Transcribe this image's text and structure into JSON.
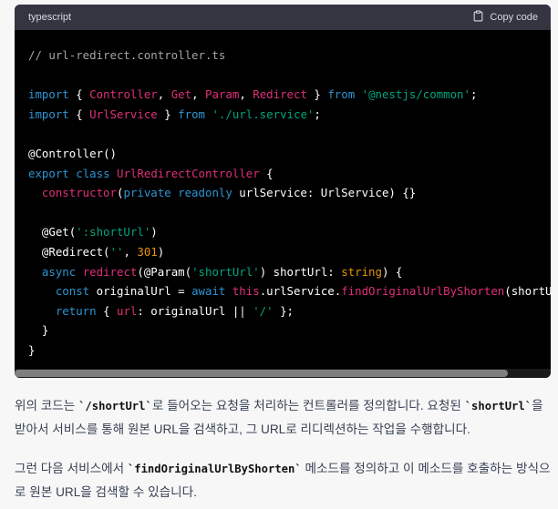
{
  "code_block": {
    "language": "typescript",
    "copy_label": "Copy code",
    "lines": [
      [
        {
          "t": "// url-redirect.controller.ts",
          "c": "c"
        }
      ],
      [],
      [
        {
          "t": "import",
          "c": "k"
        },
        {
          "t": " { ",
          "c": "w"
        },
        {
          "t": "Controller",
          "c": "r"
        },
        {
          "t": ", ",
          "c": "w"
        },
        {
          "t": "Get",
          "c": "r"
        },
        {
          "t": ", ",
          "c": "w"
        },
        {
          "t": "Param",
          "c": "r"
        },
        {
          "t": ", ",
          "c": "w"
        },
        {
          "t": "Redirect",
          "c": "r"
        },
        {
          "t": " } ",
          "c": "w"
        },
        {
          "t": "from",
          "c": "k"
        },
        {
          "t": " ",
          "c": "w"
        },
        {
          "t": "'@nestjs/common'",
          "c": "s"
        },
        {
          "t": ";",
          "c": "w"
        }
      ],
      [
        {
          "t": "import",
          "c": "k"
        },
        {
          "t": " { ",
          "c": "w"
        },
        {
          "t": "UrlService",
          "c": "r"
        },
        {
          "t": " } ",
          "c": "w"
        },
        {
          "t": "from",
          "c": "k"
        },
        {
          "t": " ",
          "c": "w"
        },
        {
          "t": "'./url.service'",
          "c": "s"
        },
        {
          "t": ";",
          "c": "w"
        }
      ],
      [],
      [
        {
          "t": "@Controller",
          "c": "w"
        },
        {
          "t": "()",
          "c": "w"
        }
      ],
      [
        {
          "t": "export",
          "c": "k"
        },
        {
          "t": " ",
          "c": "w"
        },
        {
          "t": "class",
          "c": "k"
        },
        {
          "t": " ",
          "c": "w"
        },
        {
          "t": "UrlRedirectController",
          "c": "r"
        },
        {
          "t": " {",
          "c": "w"
        }
      ],
      [
        {
          "t": "  ",
          "c": "w"
        },
        {
          "t": "constructor",
          "c": "r"
        },
        {
          "t": "(",
          "c": "w"
        },
        {
          "t": "private",
          "c": "k"
        },
        {
          "t": " ",
          "c": "w"
        },
        {
          "t": "readonly",
          "c": "k"
        },
        {
          "t": " urlService: UrlService) {}",
          "c": "w"
        }
      ],
      [],
      [
        {
          "t": "  @Get(",
          "c": "w"
        },
        {
          "t": "':shortUrl'",
          "c": "s"
        },
        {
          "t": ")",
          "c": "w"
        }
      ],
      [
        {
          "t": "  @Redirect(",
          "c": "w"
        },
        {
          "t": "''",
          "c": "s"
        },
        {
          "t": ", ",
          "c": "w"
        },
        {
          "t": "301",
          "c": "n"
        },
        {
          "t": ")",
          "c": "w"
        }
      ],
      [
        {
          "t": "  ",
          "c": "w"
        },
        {
          "t": "async",
          "c": "k"
        },
        {
          "t": " ",
          "c": "w"
        },
        {
          "t": "redirect",
          "c": "r"
        },
        {
          "t": "(@Param(",
          "c": "w"
        },
        {
          "t": "'shortUrl'",
          "c": "s"
        },
        {
          "t": ") shortUrl: ",
          "c": "w"
        },
        {
          "t": "string",
          "c": "n"
        },
        {
          "t": ") {",
          "c": "w"
        }
      ],
      [
        {
          "t": "    ",
          "c": "w"
        },
        {
          "t": "const",
          "c": "k"
        },
        {
          "t": " originalUrl = ",
          "c": "w"
        },
        {
          "t": "await",
          "c": "k"
        },
        {
          "t": " ",
          "c": "w"
        },
        {
          "t": "this",
          "c": "r"
        },
        {
          "t": ".urlService.",
          "c": "w"
        },
        {
          "t": "findOriginalUrlByShorten",
          "c": "r"
        },
        {
          "t": "(shortUrl);",
          "c": "w"
        }
      ],
      [
        {
          "t": "    ",
          "c": "w"
        },
        {
          "t": "return",
          "c": "k"
        },
        {
          "t": " { ",
          "c": "w"
        },
        {
          "t": "url",
          "c": "r"
        },
        {
          "t": ": originalUrl || ",
          "c": "w"
        },
        {
          "t": "'/'",
          "c": "s"
        },
        {
          "t": " };",
          "c": "w"
        }
      ],
      [
        {
          "t": "  }",
          "c": "w"
        }
      ],
      [
        {
          "t": "}",
          "c": "w"
        }
      ]
    ],
    "scroll_fraction": 0.92
  },
  "explanation": {
    "paragraph1": [
      {
        "t": "위의 코드는 ",
        "code": false
      },
      {
        "t": "`/shortUrl`",
        "code": true
      },
      {
        "t": "로 들어오는 요청을 처리하는 컨트롤러를 정의합니다. 요청된 ",
        "code": false
      },
      {
        "t": "`shortUrl`",
        "code": true
      },
      {
        "t": "을 받아서 서비스를 통해 원본 URL을 검색하고, 그 URL로 리디렉션하는 작업을 수행합니다.",
        "code": false
      }
    ],
    "paragraph2": [
      {
        "t": "그런 다음 서비스에서 ",
        "code": false
      },
      {
        "t": "`findOriginalUrlByShorten`",
        "code": true
      },
      {
        "t": " 메소드를 정의하고 이 메소드를 호출하는 방식으로 원본 URL을 검색할 수 있습니다.",
        "code": false
      }
    ]
  }
}
